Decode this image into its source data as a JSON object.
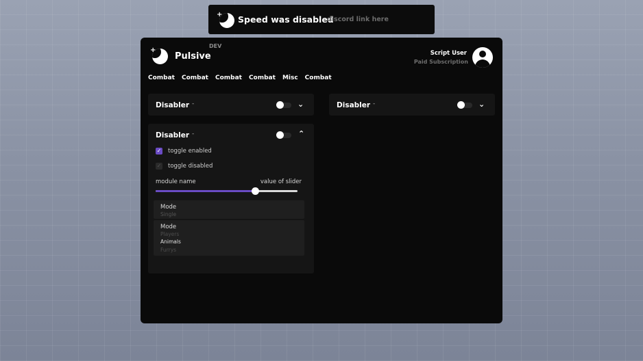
{
  "notification": {
    "title": "Speed was disabled",
    "link": "discord link here"
  },
  "app": {
    "name": "Pulsive",
    "badge": "DEV"
  },
  "user": {
    "name": "Script User",
    "subscription": "Paid Subscription"
  },
  "tabs": [
    "Combat",
    "Combat",
    "Combat",
    "Combat",
    "Misc",
    "Combat"
  ],
  "modules": {
    "left_top": {
      "title": "Disabler",
      "dash": "-"
    },
    "right_top": {
      "title": "Disabler",
      "dash": "-"
    },
    "left_expanded": {
      "title": "Disabler",
      "dash": "-",
      "checkbox_enabled": {
        "label": "toggle enabled",
        "checked": true
      },
      "checkbox_disabled": {
        "label": "toggle disabled",
        "checked": false
      },
      "slider": {
        "label": "module name",
        "value_text": "value of slider",
        "fraction": 0.7
      },
      "dropdown_single": {
        "label": "Mode",
        "value": "Single"
      },
      "dropdown_multi": {
        "label": "Mode",
        "options": [
          {
            "label": "Players",
            "selected": false
          },
          {
            "label": "Animals",
            "selected": true
          },
          {
            "label": "Furrys",
            "selected": false
          }
        ]
      }
    }
  },
  "colors": {
    "accent": "#6a4bc4",
    "panel": "#0a0a0a",
    "card": "#151515"
  }
}
